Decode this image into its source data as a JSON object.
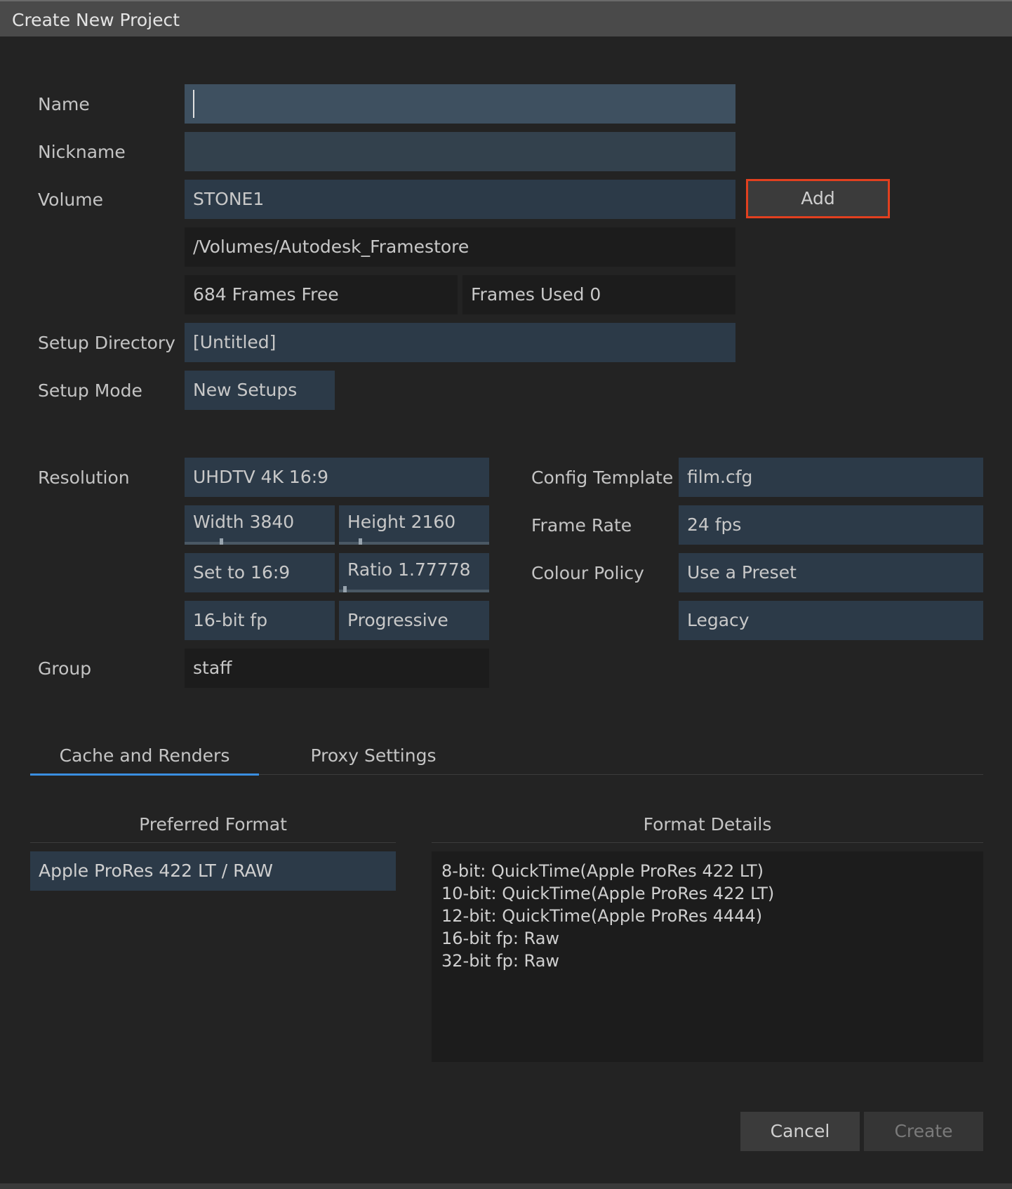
{
  "window": {
    "title": "Create New Project"
  },
  "form": {
    "name": {
      "label": "Name",
      "value": ""
    },
    "nickname": {
      "label": "Nickname",
      "value": ""
    },
    "volume": {
      "label": "Volume",
      "value": "STONE1",
      "add_label": "Add"
    },
    "volume_path": "/Volumes/Autodesk_Framestore",
    "frames_free": "684 Frames Free",
    "frames_used": "Frames Used 0",
    "setup_directory": {
      "label": "Setup Directory",
      "value": "[Untitled]"
    },
    "setup_mode": {
      "label": "Setup Mode",
      "value": "New Setups"
    }
  },
  "resolution": {
    "label": "Resolution",
    "preset": "UHDTV 4K 16:9",
    "width": "Width 3840",
    "height": "Height 2160",
    "set_ratio": "Set to 16:9",
    "ratio": "Ratio 1.77778",
    "bit_depth": "16-bit fp",
    "scan": "Progressive"
  },
  "group": {
    "label": "Group",
    "value": "staff"
  },
  "config": {
    "template_label": "Config Template",
    "template": "film.cfg",
    "frame_rate_label": "Frame Rate",
    "frame_rate": "24 fps",
    "colour_policy_label": "Colour Policy",
    "colour_policy": "Use a Preset",
    "colour_preset": "Legacy"
  },
  "tabs": [
    {
      "label": "Cache and Renders",
      "active": true
    },
    {
      "label": "Proxy Settings",
      "active": false
    }
  ],
  "cache": {
    "preferred_header": "Preferred Format",
    "details_header": "Format Details",
    "formats": [
      "Apple ProRes 422 LT / RAW"
    ],
    "details": [
      "8-bit: QuickTime(Apple ProRes 422 LT)",
      "10-bit: QuickTime(Apple ProRes 422 LT)",
      "12-bit: QuickTime(Apple ProRes 4444)",
      "16-bit fp: Raw",
      "32-bit fp: Raw"
    ]
  },
  "actions": {
    "cancel": "Cancel",
    "create": "Create"
  },
  "colors": {
    "accent_tab": "#3a8ee0",
    "add_highlight": "#e2401f",
    "field_bg": "#2c3a48",
    "dialog_bg": "#232323"
  }
}
